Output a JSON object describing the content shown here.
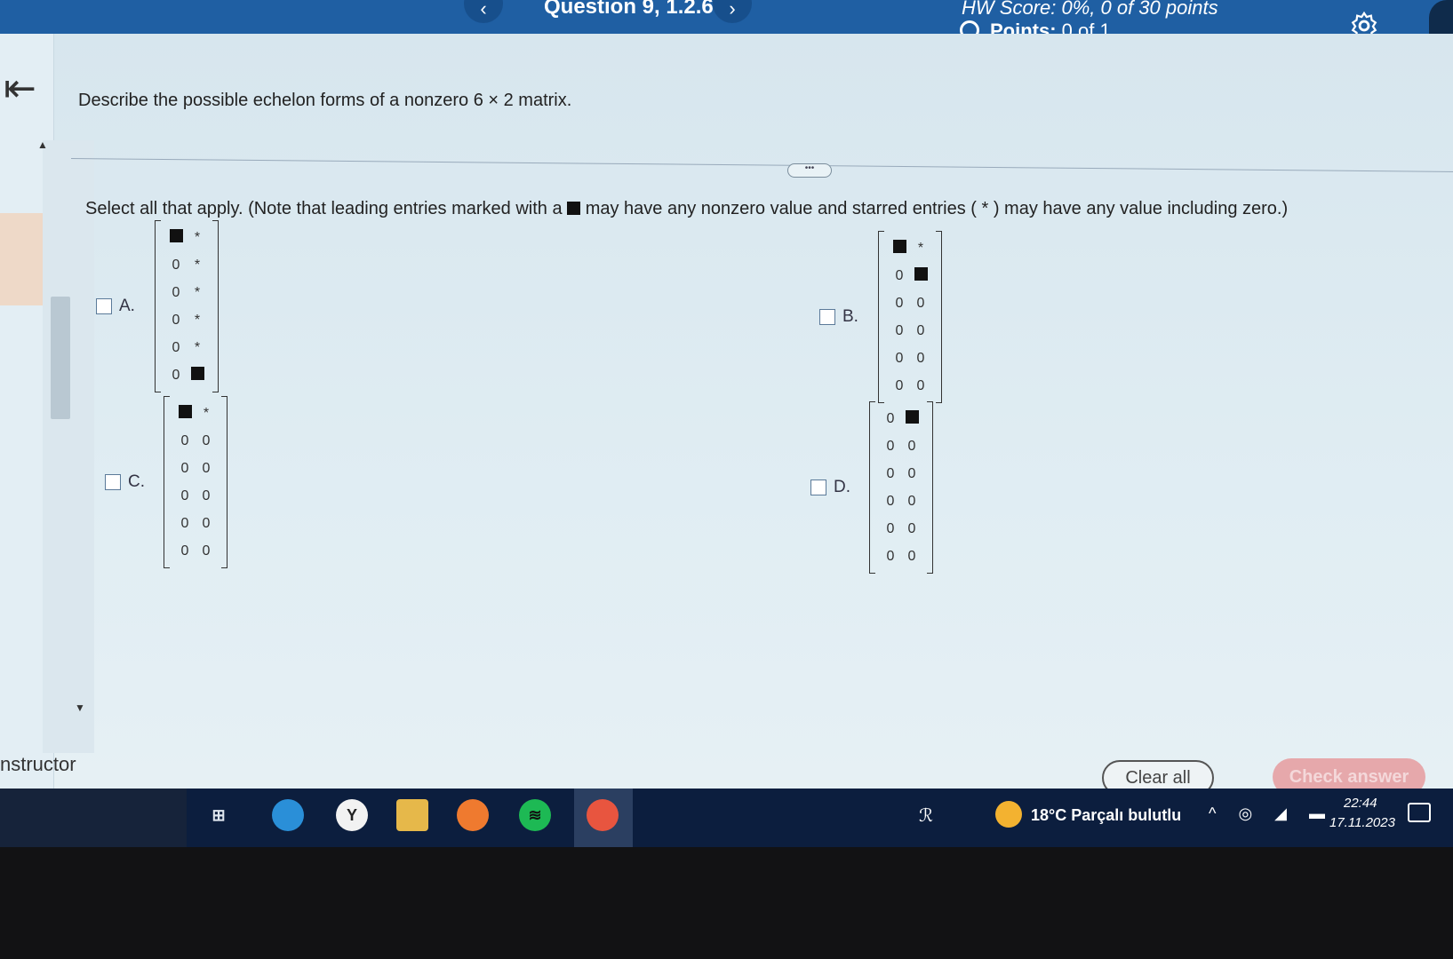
{
  "header": {
    "prev_arrow": "‹",
    "question_title": "Question 9, 1.2.6",
    "next_arrow": "›",
    "hw_score": "HW Score: 0%, 0 of 30 points",
    "points_label": "Points:",
    "points_value": " 0 of 1"
  },
  "sidebar": {
    "back_glyph": "⇤",
    "instructor_text": "nstructor"
  },
  "question": {
    "prompt": "Describe the possible echelon forms of a nonzero 6 × 2 matrix.",
    "instruction_before": "Select all that apply. (Note that leading entries marked with a ",
    "instruction_after": " may have any nonzero value and starred entries ( * ) may have any value including zero.)",
    "divider_handle": "•••"
  },
  "options": [
    {
      "label": "A.",
      "matrix": [
        [
          "■",
          "*"
        ],
        [
          "0",
          "*"
        ],
        [
          "0",
          "*"
        ],
        [
          "0",
          "*"
        ],
        [
          "0",
          "*"
        ],
        [
          "0",
          "■"
        ]
      ]
    },
    {
      "label": "B.",
      "matrix": [
        [
          "■",
          "*"
        ],
        [
          "0",
          "■"
        ],
        [
          "0",
          "0"
        ],
        [
          "0",
          "0"
        ],
        [
          "0",
          "0"
        ],
        [
          "0",
          "0"
        ]
      ]
    },
    {
      "label": "C.",
      "matrix": [
        [
          "■",
          "*"
        ],
        [
          "0",
          "0"
        ],
        [
          "0",
          "0"
        ],
        [
          "0",
          "0"
        ],
        [
          "0",
          "0"
        ],
        [
          "0",
          "0"
        ]
      ]
    },
    {
      "label": "D.",
      "matrix": [
        [
          "0",
          "■"
        ],
        [
          "0",
          "0"
        ],
        [
          "0",
          "0"
        ],
        [
          "0",
          "0"
        ],
        [
          "0",
          "0"
        ],
        [
          "0",
          "0"
        ]
      ]
    }
  ],
  "buttons": {
    "clear_all": "Clear all",
    "check_answer": "Check answer"
  },
  "taskbar": {
    "weather": "18°C  Parçalı bulutlu",
    "time": "22:44",
    "date": "17.11.2023",
    "people_glyph": "ℛ",
    "tray_glyphs": "^ ◎ ◢ ▬"
  },
  "colors": {
    "header_blue": "#1f5fa3",
    "check_answer_bg": "#e6a8ab",
    "taskbar": "#0c1e3e"
  }
}
